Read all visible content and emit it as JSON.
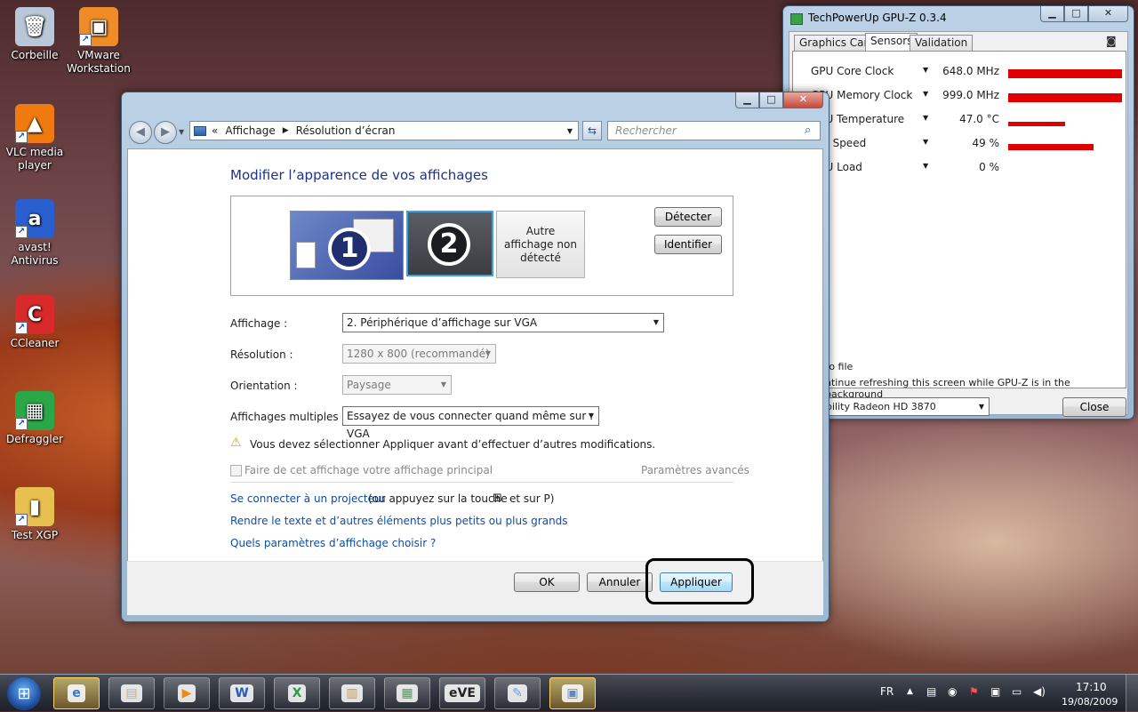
{
  "desktop": {
    "icons": [
      {
        "label": "Corbeille",
        "glyph": "🗑",
        "color": "#b8c8d8"
      },
      {
        "label": "VMware\nWorkstation",
        "glyph": "▣",
        "color": "#f08c28"
      },
      {
        "label": "VLC media\nplayer",
        "glyph": "▲",
        "color": "#f07a10"
      },
      {
        "label": "avast!\nAntivirus",
        "glyph": "a",
        "color": "#2a5fcf"
      },
      {
        "label": "CCleaner",
        "glyph": "C",
        "color": "#d82a2a"
      },
      {
        "label": "Defraggler",
        "glyph": "▦",
        "color": "#2aa848"
      },
      {
        "label": "Test XGP",
        "glyph": "▮",
        "color": "#e8c050"
      }
    ]
  },
  "display_window": {
    "breadcrumb_prefix": "«",
    "breadcrumb": [
      "Affichage",
      "Résolution d’écran"
    ],
    "search_placeholder": "Rechercher",
    "heading": "Modifier l’apparence de vos affichages",
    "monitors": [
      "1",
      "2",
      "Autre affichage non détecté"
    ],
    "detect_label": "Détecter",
    "identify_label": "Identifier",
    "fields": {
      "display_label": "Affichage :",
      "display_value": "2. Périphérique d’affichage sur VGA",
      "resolution_label": "Résolution :",
      "resolution_value": "1280 x 800 (recommandé)",
      "orientation_label": "Orientation :",
      "orientation_value": "Paysage",
      "multiple_label": "Affichages multiples :",
      "multiple_value": "Essayez de vous connecter quand même sur : VGA"
    },
    "warning": "Vous devez sélectionner Appliquer avant d’effectuer d’autres modifications.",
    "primary_checkbox": "Faire de cet affichage votre affichage principal",
    "advanced_link": "Paramètres avancés",
    "projector_link": "Se connecter à un projecteur",
    "projector_suffix": "(ou appuyez sur la touche",
    "projector_suffix2": "et sur P)",
    "text_size_link": "Rendre le texte et d’autres éléments plus petits ou plus grands",
    "which_settings_link": "Quels paramètres d’affichage choisir ?",
    "ok_label": "OK",
    "cancel_label": "Annuler",
    "apply_label": "Appliquer"
  },
  "gpuz": {
    "title": "TechPowerUp GPU-Z 0.3.4",
    "tabs": [
      "Graphics Card",
      "Sensors",
      "Validation"
    ],
    "active_tab": "Sensors",
    "sensors": [
      {
        "name": "GPU Core Clock",
        "value": "648.0 MHz",
        "level": 1.0
      },
      {
        "name": "GPU Memory Clock",
        "value": "999.0 MHz",
        "level": 1.0
      },
      {
        "name": "GPU Temperature",
        "value": "47.0 °C",
        "level": 0.5
      },
      {
        "name": "Fan Speed",
        "value": "49 %",
        "level": 0.75
      },
      {
        "name": "GPU Load",
        "value": "0 %",
        "level": 0
      }
    ],
    "log_label": "to file",
    "refresh_label": "ntinue refreshing this screen while GPU-Z is in the background",
    "card_value": "bility Radeon HD 3870",
    "close_label": "Close"
  },
  "taskbar": {
    "items": [
      "Explorer",
      "Media Player",
      "Word",
      "Excel",
      "Dossier",
      "Réseau",
      "EVE",
      "Paint",
      "Résolution d'écran"
    ],
    "language": "FR",
    "time": "17:10",
    "date": "19/08/2009"
  }
}
